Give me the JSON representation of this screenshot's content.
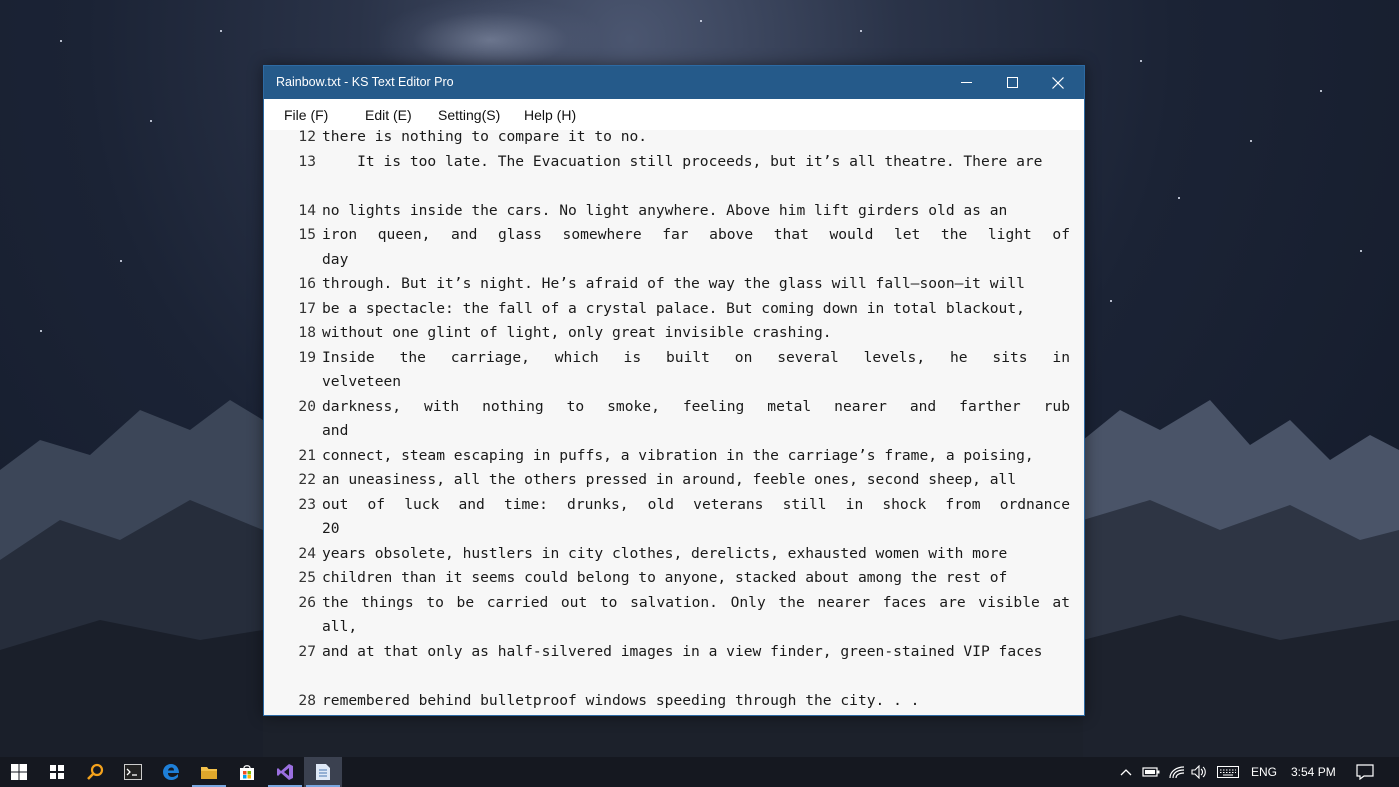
{
  "window": {
    "title": "Rainbow.txt  - KS Text Editor Pro",
    "controls": {
      "minimize": "minimize-icon",
      "maximize": "maximize-icon",
      "close": "close-icon"
    }
  },
  "menu": {
    "file": "File (F)",
    "edit": "Edit (E)",
    "settings": "Setting(S)",
    "help": "Help (H)"
  },
  "editor": {
    "lines": [
      {
        "n": "12",
        "rows": [
          "there is nothing to compare it to no."
        ]
      },
      {
        "n": "13",
        "rows": [
          "    It is too late. The Evacuation still proceeds, but it’s all theatre. There are",
          ""
        ]
      },
      {
        "n": "14",
        "rows": [
          "no lights inside the cars. No light anywhere. Above him lift girders old as an"
        ]
      },
      {
        "n": "15",
        "rows": [
          "iron queen, and glass somewhere far above that would let the light of",
          "day"
        ]
      },
      {
        "n": "16",
        "rows": [
          "through. But it’s night. He’s afraid of the way the glass will fall—soon—it will"
        ]
      },
      {
        "n": "17",
        "rows": [
          "be a spectacle: the fall of a crystal palace. But coming down in total blackout,"
        ]
      },
      {
        "n": "18",
        "rows": [
          "without one glint of light, only great invisible crashing."
        ]
      },
      {
        "n": "19",
        "rows": [
          "    Inside the carriage, which is built on several levels, he sits in",
          "velveteen"
        ]
      },
      {
        "n": "20",
        "rows": [
          "darkness, with nothing to smoke, feeling metal nearer and farther rub",
          "and"
        ]
      },
      {
        "n": "21",
        "rows": [
          "connect, steam escaping in puffs, a vibration in the carriage’s frame, a poising,"
        ]
      },
      {
        "n": "22",
        "rows": [
          "an uneasiness, all the others pressed in around, feeble ones, second sheep, all"
        ]
      },
      {
        "n": "23",
        "rows": [
          "out of luck and time: drunks, old veterans still in shock from ordnance",
          "20"
        ]
      },
      {
        "n": "24",
        "rows": [
          "years obsolete, hustlers in city clothes, derelicts, exhausted women with more"
        ]
      },
      {
        "n": "25",
        "rows": [
          "children than it seems could belong to anyone, stacked about among the rest of"
        ]
      },
      {
        "n": "26",
        "rows": [
          "the things to be carried out to salvation. Only the nearer faces are visible at",
          "all,"
        ]
      },
      {
        "n": "27",
        "rows": [
          "and at that only as half-silvered images in a view finder, green-stained VIP faces",
          ""
        ]
      },
      {
        "n": "28",
        "rows": [
          "remembered behind bulletproof windows speeding through the city. . ."
        ]
      }
    ]
  },
  "taskbar": {
    "language": "ENG",
    "time": "3:54 PM"
  }
}
